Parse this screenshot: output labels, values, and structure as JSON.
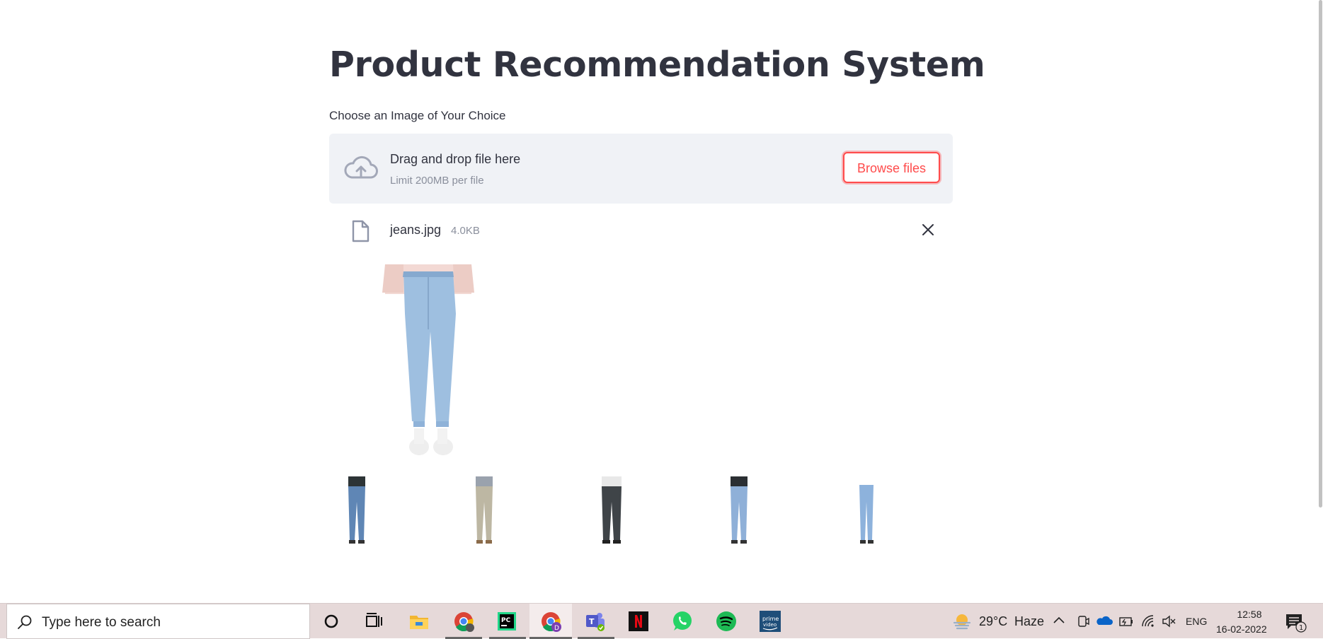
{
  "app": {
    "title": "Product Recommendation System",
    "uploader_label": "Choose an Image of Your Choice",
    "dropzone": {
      "title": "Drag and drop file here",
      "subtitle": "Limit 200MB per file",
      "browse_label": "Browse files"
    },
    "uploaded_file": {
      "name": "jeans.jpg",
      "size": "4.0KB"
    },
    "recommendations": [
      {
        "name": "dark-wash-skinny-jeans",
        "shirt": "#2d3436",
        "pants": "#5f86b5"
      },
      {
        "name": "beige-skinny-pants",
        "shirt": "#9aa2ad",
        "pants": "#bdb7a3"
      },
      {
        "name": "dark-grey-trousers",
        "shirt": "#e8e8e8",
        "pants": "#3f4448"
      },
      {
        "name": "light-wash-skinny-jeans",
        "shirt": "#2b2f33",
        "pants": "#8fb0d8"
      },
      {
        "name": "light-blue-skinny-jeans",
        "shirt": "#ffffff",
        "pants": "#8db2dc"
      }
    ]
  },
  "taskbar": {
    "search_placeholder": "Type here to search",
    "apps": [
      "cortana-icon",
      "task-view-icon",
      "file-explorer-icon",
      "chrome-icon",
      "pycharm-icon",
      "chrome-profile-icon",
      "teams-icon",
      "netflix-icon",
      "whatsapp-icon",
      "spotify-icon",
      "prime-video-icon"
    ],
    "weather": {
      "temp": "29°C",
      "condition": "Haze"
    },
    "language": "ENG",
    "time": "12:58",
    "date": "16-02-2022",
    "notification_count": "1",
    "colors": {
      "accent": "#ff4b4b",
      "taskbar": "#e6d9d9"
    }
  }
}
